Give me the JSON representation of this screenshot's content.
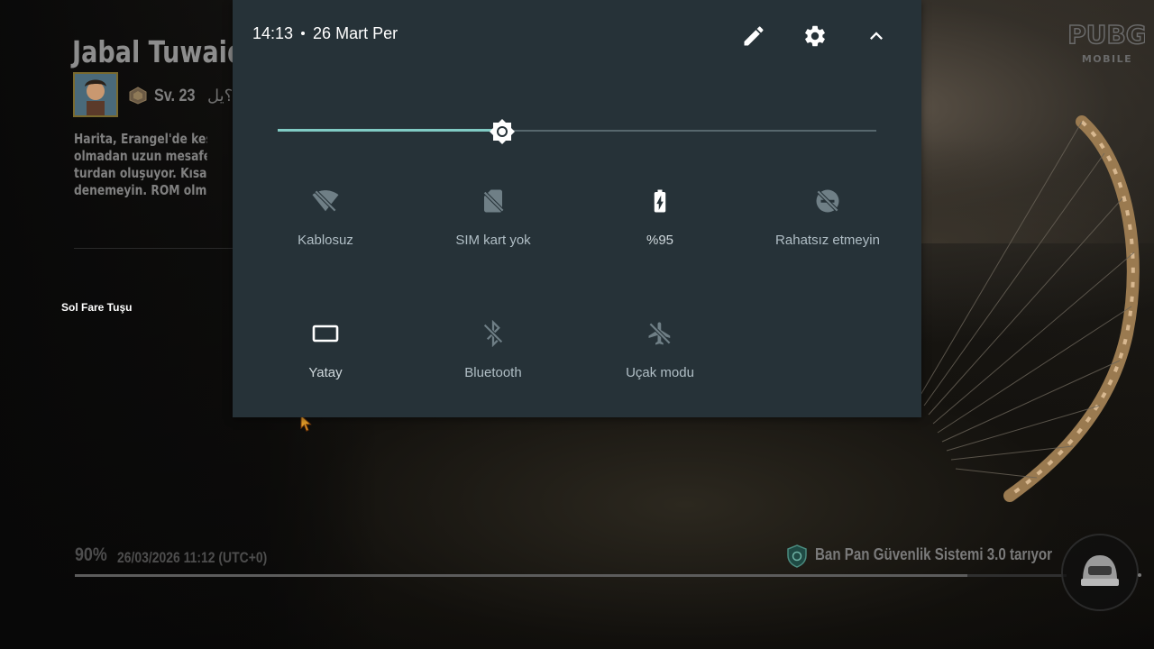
{
  "game_background": {
    "map_title": "Jabal Tuwaiq Z",
    "player_level": "Sv. 23",
    "arabic_snippet": "؟يل",
    "description_lines": [
      "Harita, Erangel'de keskin",
      "olmadan uzun mesafelerd",
      "turdan oluşuyor. Kısacası",
      "denemeyin. ROM olmadan"
    ],
    "mouse_label": "Sol Fare Tuşu",
    "logo_line1": "PUBG",
    "logo_line2": "MOBILE",
    "load_percent": "90%",
    "load_progress": 0.9,
    "datetime": "26/03/2026 11:12 (UTC+0)",
    "security_message": "Ban Pan Güvenlik Sistemi 3.0 tarıyor"
  },
  "quick_settings": {
    "time": "14:13",
    "date": "26 Mart Per",
    "brightness": 0.375,
    "accent_color": "#80cbc4",
    "panel_color": "#263238",
    "tiles": [
      {
        "label": "Kablosuz",
        "icon": "wifi-off-icon",
        "active": false
      },
      {
        "label": "SIM kart yok",
        "icon": "sim-card-absent-icon",
        "active": false
      },
      {
        "label": "%95",
        "icon": "battery-charging-icon",
        "active": true
      },
      {
        "label": "Rahatsız etmeyin",
        "icon": "do-not-disturb-off-icon",
        "active": false
      },
      {
        "label": "Yatay",
        "icon": "screen-rotation-landscape-icon",
        "active": true
      },
      {
        "label": "Bluetooth",
        "icon": "bluetooth-disabled-icon",
        "active": false
      },
      {
        "label": "Uçak modu",
        "icon": "airplane-mode-off-icon",
        "active": false
      }
    ]
  }
}
